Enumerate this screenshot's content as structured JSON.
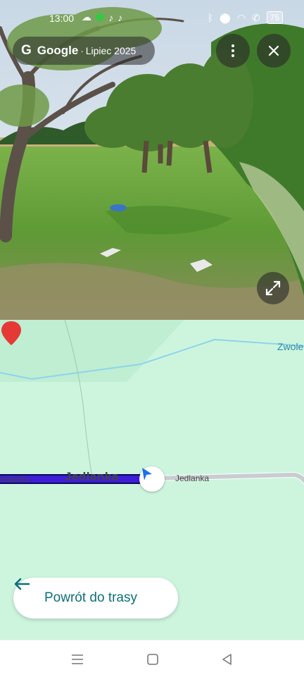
{
  "status_bar": {
    "time": "13:00",
    "battery": "75"
  },
  "streetview": {
    "header": {
      "logo_letter": "G",
      "brand": "Google",
      "separator": "·",
      "date": "Lipiec 2025"
    },
    "icons": [
      "more-vert-icon",
      "close-icon",
      "expand-icon",
      "move-arrow-left-icon",
      "move-arrow-right-icon"
    ]
  },
  "map": {
    "road_labels": {
      "main_big": "Jedlanka",
      "left": "Jedlanka",
      "right": "Jedlanka",
      "top_right": "Zwole"
    },
    "colors": {
      "land": "#cdf5de",
      "route": "#3d1ed6",
      "river": "#8fd3ec",
      "pin": "#e53935",
      "nav_arrow": "#1a73e8"
    }
  },
  "back_button": {
    "label": "Powrót do trasy"
  },
  "system_nav": {
    "icons": [
      "menu-icon",
      "home-icon",
      "back-icon"
    ]
  }
}
